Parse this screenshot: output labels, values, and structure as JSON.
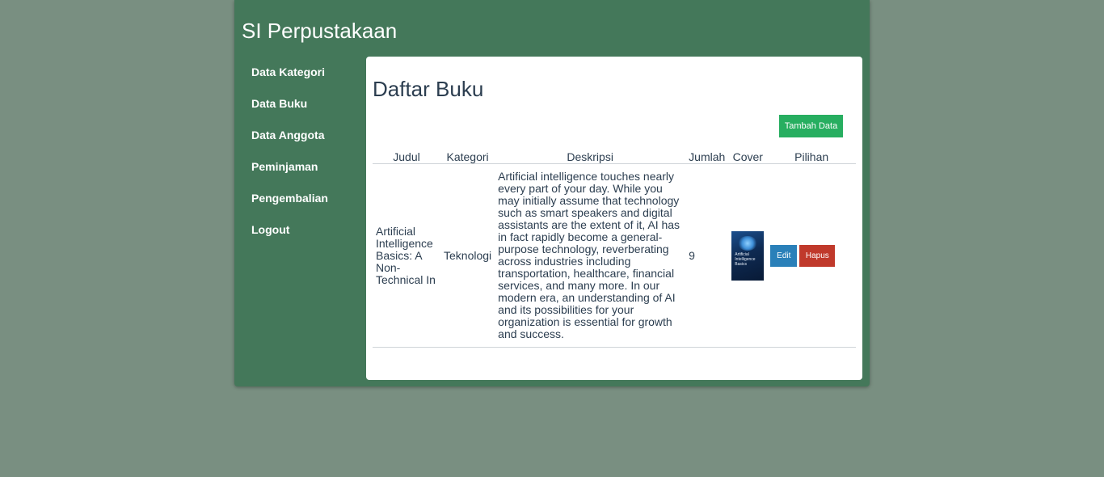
{
  "app": {
    "title": "SI Perpustakaan"
  },
  "sidebar": {
    "items": [
      {
        "label": "Data Kategori"
      },
      {
        "label": "Data Buku"
      },
      {
        "label": "Data Anggota"
      },
      {
        "label": "Peminjaman"
      },
      {
        "label": "Pengembalian"
      },
      {
        "label": "Logout"
      }
    ]
  },
  "main": {
    "title": "Daftar Buku",
    "add_button_label": "Tambah Data",
    "table": {
      "columns": [
        "Judul",
        "Kategori",
        "Deskripsi",
        "Jumlah",
        "Cover",
        "Pilihan"
      ],
      "rows": [
        {
          "judul": "Artificial Intelligence Basics: A Non-Technical In",
          "kategori": "Teknologi",
          "deskripsi": "Artificial intelligence touches nearly every part of your day. While you may initially assume that technology such as smart speakers and digital assistants are the extent of it, AI has in fact rapidly become a general-purpose technology, reverberating across industries including transportation, healthcare, financial services, and many more. In our modern era, an understanding of AI and its possibilities for your organization is essential for growth and success.",
          "jumlah": "9",
          "cover_text": "Artificial Intelligence Basics",
          "edit_label": "Edit",
          "hapus_label": "Hapus"
        }
      ]
    }
  },
  "colors": {
    "page_background": "#798f81",
    "app_green": "#44785a",
    "add_button": "#27ae60",
    "edit_button": "#2a80b9",
    "delete_button": "#c0392b",
    "text_dark": "#2c3e50"
  },
  "icons": {
    "cover": "book-cover-image"
  }
}
